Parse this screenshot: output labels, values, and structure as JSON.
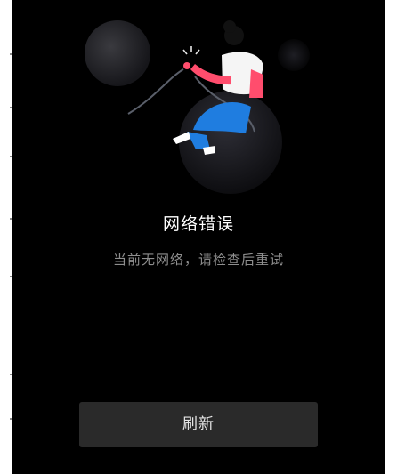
{
  "error": {
    "title": "网络错误",
    "message": "当前无网络，请检查后重试"
  },
  "actions": {
    "refresh_label": "刷新"
  },
  "illustration": {
    "icon": "person-holding-unplugged-cable-illustration",
    "colors": {
      "background": "#000000",
      "shirt": "#f5f5f5",
      "pants": "#1f7de0",
      "arm": "#ff4d6d",
      "hair": "#111111"
    }
  }
}
